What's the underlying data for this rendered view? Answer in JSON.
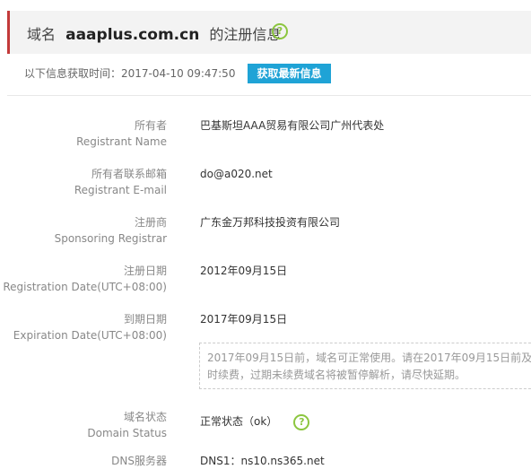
{
  "header": {
    "prefix": "域名",
    "domain": "aaaplus.com.cn",
    "suffix": "的注册信息",
    "help_icon": "question-circle-icon"
  },
  "fetch": {
    "label": "以下信息获取时间：2017-04-10 09:47:50",
    "refresh_button": "获取最新信息"
  },
  "records": {
    "owner": {
      "label_cn": "所有者",
      "label_en": "Registrant Name",
      "value": "巴基斯坦AAA贸易有限公司广州代表处"
    },
    "email": {
      "label_cn": "所有者联系邮箱",
      "label_en": "Registrant E-mail",
      "value": "do@a020.net"
    },
    "registrar": {
      "label_cn": "注册商",
      "label_en": "Sponsoring Registrar",
      "value": "广东金万邦科技投资有限公司"
    },
    "reg_date": {
      "label_cn": "注册日期",
      "label_en": "Registration Date(UTC+08:00)",
      "value": "2012年09月15日"
    },
    "exp_date": {
      "label_cn": "到期日期",
      "label_en": "Expiration Date(UTC+08:00)",
      "value": "2017年09月15日"
    },
    "exp_note": "2017年09月15日前，域名可正常使用。请在2017年09月15日前及时续费，过期未续费域名将被暂停解析，请尽快延期。",
    "status": {
      "label_cn": "域名状态",
      "label_en": "Domain Status",
      "value": "正常状态（ok）"
    },
    "dns": {
      "label_cn": "DNS服务器",
      "value": "DNS1：ns10.ns365.net"
    }
  },
  "colors": {
    "accent_red": "#c33a3a",
    "button_blue": "#1fa3d6",
    "help_green": "#8cc63f"
  }
}
